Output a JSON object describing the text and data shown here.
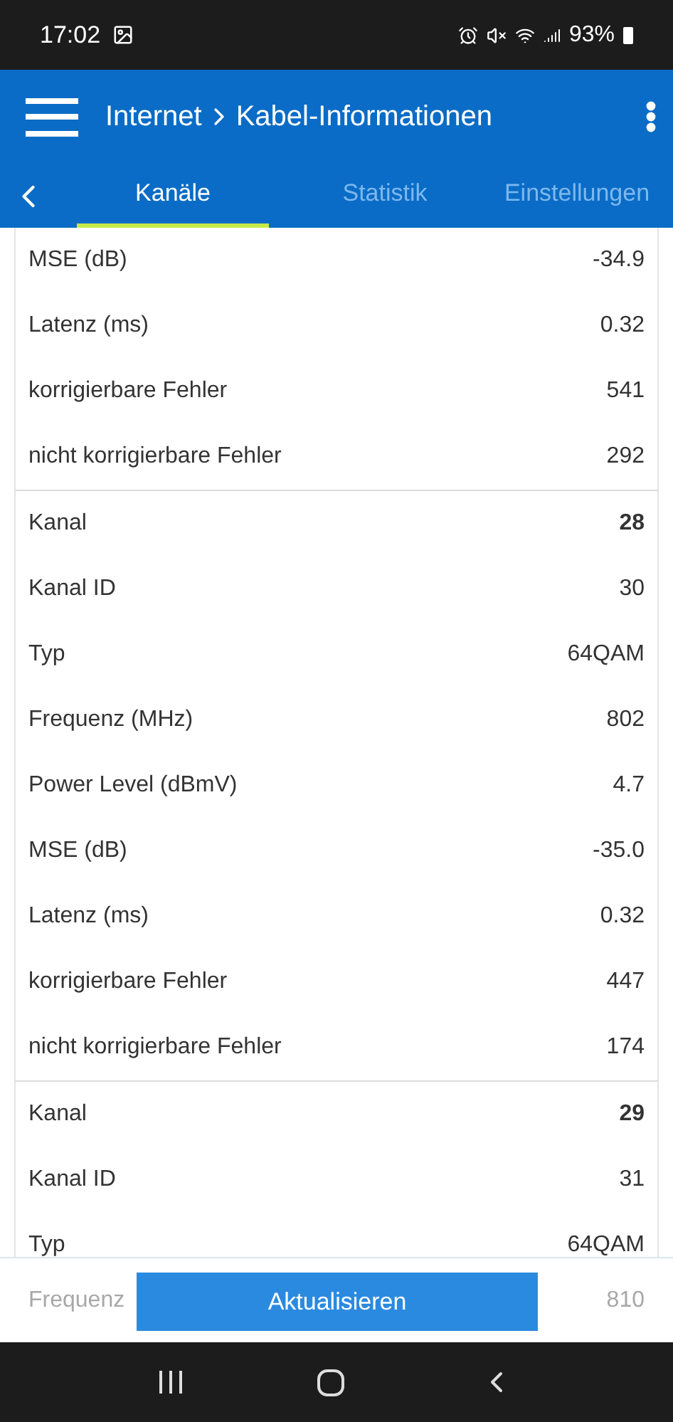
{
  "status_bar": {
    "time": "17:02",
    "battery": "93%"
  },
  "header": {
    "title": "Internet",
    "subtitle": "Kabel-Informationen"
  },
  "tabs": [
    {
      "label": "Kanäle",
      "selected": true
    },
    {
      "label": "Statistik",
      "selected": false
    },
    {
      "label": "Einstellungen",
      "selected": false
    }
  ],
  "groups": [
    {
      "rows": [
        {
          "kind": "field",
          "label": "MSE (dB)",
          "value": "-34.9"
        },
        {
          "kind": "field",
          "label": "Latenz (ms)",
          "value": "0.32"
        },
        {
          "kind": "field",
          "label": "korrigierbare Fehler",
          "value": "541"
        },
        {
          "kind": "field",
          "label": "nicht korrigierbare Fehler",
          "value": "292"
        }
      ]
    },
    {
      "rows": [
        {
          "kind": "channel",
          "label": "Kanal",
          "value": "28"
        },
        {
          "kind": "field",
          "label": "Kanal ID",
          "value": "30"
        },
        {
          "kind": "field",
          "label": "Typ",
          "value": "64QAM"
        },
        {
          "kind": "field",
          "label": "Frequenz (MHz)",
          "value": "802"
        },
        {
          "kind": "field",
          "label": "Power Level (dBmV)",
          "value": "4.7"
        },
        {
          "kind": "field",
          "label": "MSE (dB)",
          "value": "-35.0"
        },
        {
          "kind": "field",
          "label": "Latenz (ms)",
          "value": "0.32"
        },
        {
          "kind": "field",
          "label": "korrigierbare Fehler",
          "value": "447"
        },
        {
          "kind": "field",
          "label": "nicht korrigierbare Fehler",
          "value": "174"
        }
      ]
    },
    {
      "rows": [
        {
          "kind": "channel",
          "label": "Kanal",
          "value": "29"
        },
        {
          "kind": "field",
          "label": "Kanal ID",
          "value": "31"
        },
        {
          "kind": "field",
          "label": "Typ",
          "value": "64QAM"
        }
      ]
    }
  ],
  "footer": {
    "faded_row": {
      "label": "Frequenz",
      "value": "810"
    },
    "button": "Aktualisieren"
  }
}
